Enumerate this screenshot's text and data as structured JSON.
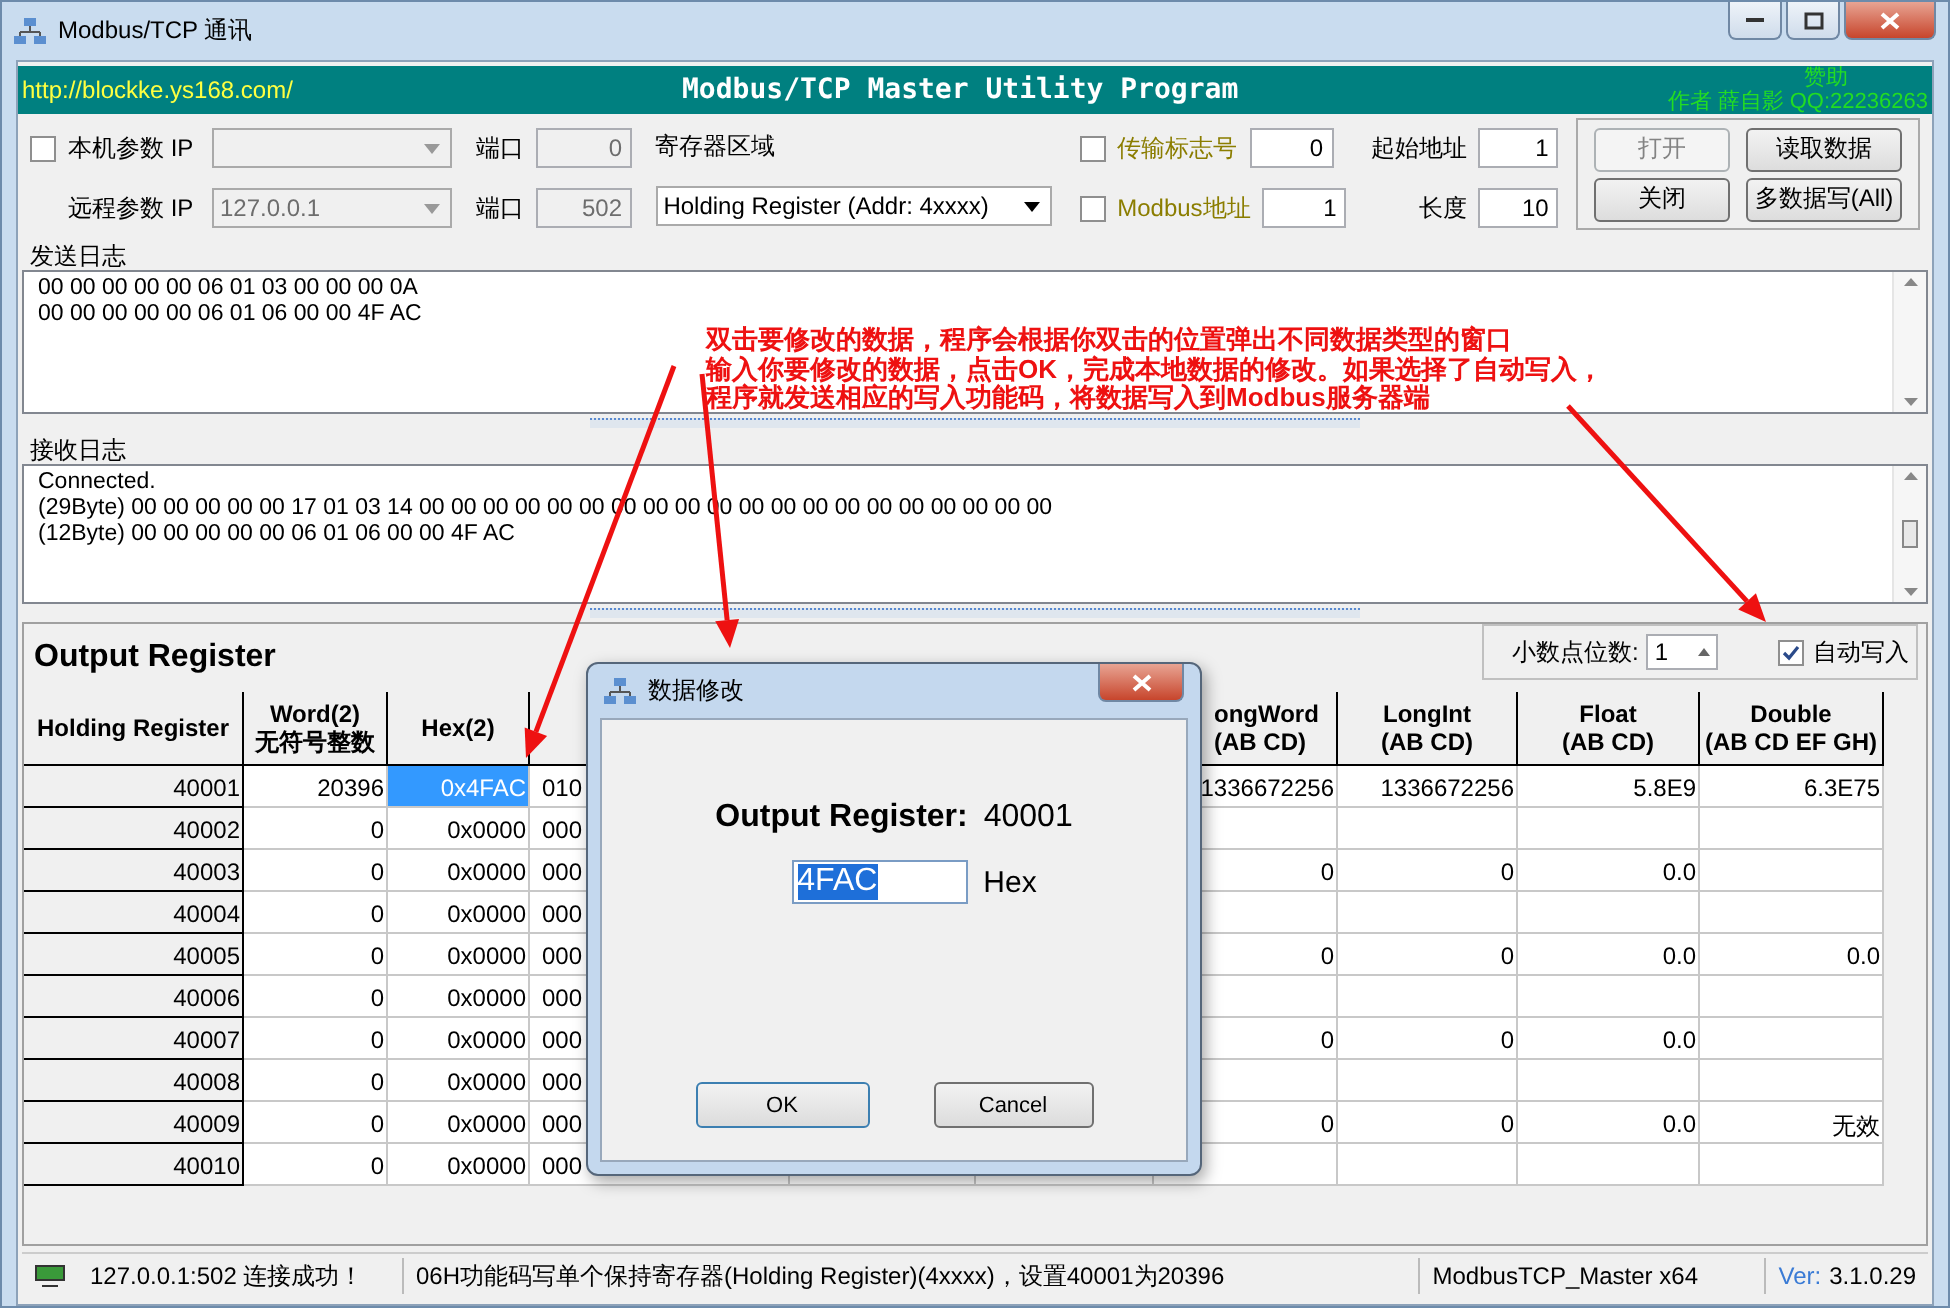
{
  "window": {
    "title": "Modbus/TCP 通讯"
  },
  "header": {
    "link": "http://blockke.ys168.com/",
    "title": "Modbus/TCP Master Utility Program",
    "sponsor": "赞助",
    "author": "作者 薛自影 QQ:22236263"
  },
  "connection": {
    "local": {
      "label": "本机参数 IP",
      "checked": false,
      "port_label": "端口",
      "port": "0"
    },
    "remote": {
      "label": "远程参数 IP",
      "ip": "127.0.0.1",
      "port_label": "端口",
      "port": "502"
    }
  },
  "register_area": {
    "label": "寄存器区域",
    "value": "Holding Register (Addr: 4xxxx)"
  },
  "options": [
    {
      "label": "传输标志号",
      "checked": false,
      "value": "0"
    },
    {
      "label": "Modbus地址",
      "checked": false,
      "value": "1"
    }
  ],
  "address": [
    {
      "label": "起始地址",
      "value": "1"
    },
    {
      "label": "长度",
      "value": "10"
    }
  ],
  "buttons": [
    {
      "label": "打开",
      "disabled": true
    },
    {
      "label": "读取数据",
      "disabled": false
    },
    {
      "label": "关闭",
      "disabled": false
    },
    {
      "label": "多数据写(All)",
      "disabled": false
    }
  ],
  "send_log": {
    "title": "发送日志",
    "lines": [
      "00 00 00 00 00 06 01 03 00 00 00 0A",
      "00 00 00 00 00 06 01 06 00 00 4F AC"
    ]
  },
  "receive_log": {
    "title": "接收日志",
    "lines": [
      "Connected.",
      "(29Byte) 00 00 00 00 00 17 01 03 14 00 00 00 00 00 00 00 00 00 00 00 00 00 00 00 00 00 00 00 00",
      "(12Byte) 00 00 00 00 00 06 01 06 00 00 4F AC"
    ]
  },
  "annotation": {
    "lines": [
      "双击要修改的数据，程序会根据你双击的位置弹出不同数据类型的窗口",
      "输入你要修改的数据，点击OK，完成本地数据的修改。如果选择了自动写入，",
      "程序就发送相应的写入功能码，将数据写入到Modbus服务器端"
    ]
  },
  "output": {
    "title": "Output Register",
    "decimal_label": "小数点位数:",
    "decimal_value": "1",
    "auto_write": {
      "label": "自动写入",
      "checked": true
    },
    "columns": [
      {
        "kind": "header",
        "label": "Holding Register"
      },
      {
        "kind": "header",
        "label": "Word(2)",
        "sublabel": "无符号整数"
      },
      {
        "kind": "header",
        "label": "Hex(2)"
      },
      {
        "kind": "blank"
      },
      {
        "kind": "header",
        "label": "ongWord",
        "sublabel": "(AB CD)"
      },
      {
        "kind": "header",
        "label": "LongInt",
        "sublabel": "(AB CD)"
      },
      {
        "kind": "header",
        "label": "Float",
        "sublabel": "(AB CD)"
      },
      {
        "kind": "header",
        "label": "Double",
        "sublabel": "(AB CD EF GH)"
      }
    ],
    "rows": [
      {
        "cells": [
          {
            "text": "40001",
            "selected": false
          },
          {
            "text": "20396",
            "selected": false
          },
          {
            "text": "0x4FAC",
            "selected": true
          },
          {
            "text": "010",
            "selected": false
          },
          {
            "text": "1336672256",
            "selected": false
          },
          {
            "text": "1336672256",
            "selected": false
          },
          {
            "text": "5.8E9",
            "selected": false
          },
          {
            "text": "6.3E75",
            "selected": false
          }
        ]
      },
      {
        "cells": [
          {
            "text": "40002",
            "selected": false
          },
          {
            "text": "0",
            "selected": false
          },
          {
            "text": "0x0000",
            "selected": false
          },
          {
            "text": "000",
            "selected": false
          },
          {
            "selected": false
          },
          {
            "selected": false
          },
          {
            "selected": false
          },
          {
            "selected": false
          }
        ]
      },
      {
        "cells": [
          {
            "text": "40003",
            "selected": false
          },
          {
            "text": "0",
            "selected": false
          },
          {
            "text": "0x0000",
            "selected": false
          },
          {
            "text": "000",
            "selected": false
          },
          {
            "text": "0",
            "selected": false
          },
          {
            "text": "0",
            "selected": false
          },
          {
            "text": "0.0",
            "selected": false
          },
          {
            "selected": false
          }
        ]
      },
      {
        "cells": [
          {
            "text": "40004",
            "selected": false
          },
          {
            "text": "0",
            "selected": false
          },
          {
            "text": "0x0000",
            "selected": false
          },
          {
            "text": "000",
            "selected": false
          },
          {
            "selected": false
          },
          {
            "selected": false
          },
          {
            "selected": false
          },
          {
            "selected": false
          }
        ]
      },
      {
        "cells": [
          {
            "text": "40005",
            "selected": false
          },
          {
            "text": "0",
            "selected": false
          },
          {
            "text": "0x0000",
            "selected": false
          },
          {
            "text": "000",
            "selected": false
          },
          {
            "text": "0",
            "selected": false
          },
          {
            "text": "0",
            "selected": false
          },
          {
            "text": "0.0",
            "selected": false
          },
          {
            "text": "0.0",
            "selected": false
          }
        ]
      },
      {
        "cells": [
          {
            "text": "40006",
            "selected": false
          },
          {
            "text": "0",
            "selected": false
          },
          {
            "text": "0x0000",
            "selected": false
          },
          {
            "text": "000",
            "selected": false
          },
          {
            "selected": false
          },
          {
            "selected": false
          },
          {
            "selected": false
          },
          {
            "selected": false
          }
        ]
      },
      {
        "cells": [
          {
            "text": "40007",
            "selected": false
          },
          {
            "text": "0",
            "selected": false
          },
          {
            "text": "0x0000",
            "selected": false
          },
          {
            "text": "000",
            "selected": false
          },
          {
            "text": "0",
            "selected": false
          },
          {
            "text": "0",
            "selected": false
          },
          {
            "text": "0.0",
            "selected": false
          },
          {
            "selected": false
          }
        ]
      },
      {
        "cells": [
          {
            "text": "40008",
            "selected": false
          },
          {
            "text": "0",
            "selected": false
          },
          {
            "text": "0x0000",
            "selected": false
          },
          {
            "text": "000",
            "selected": false
          },
          {
            "selected": false
          },
          {
            "selected": false
          },
          {
            "selected": false
          },
          {
            "selected": false
          }
        ]
      },
      {
        "cells": [
          {
            "text": "40009",
            "selected": false
          },
          {
            "text": "0",
            "selected": false
          },
          {
            "text": "0x0000",
            "selected": false
          },
          {
            "text": "000",
            "selected": false
          },
          {
            "text": "0",
            "selected": false
          },
          {
            "text": "0",
            "selected": false
          },
          {
            "text": "0.0",
            "selected": false
          },
          {
            "text": "无效",
            "selected": false
          }
        ]
      },
      {
        "cells": [
          {
            "text": "40010",
            "selected": false
          },
          {
            "text": "0",
            "selected": false
          },
          {
            "text": "0x0000",
            "selected": false
          },
          {
            "text": "000",
            "selected": false
          },
          {
            "selected": false
          },
          {
            "selected": false
          },
          {
            "selected": false
          },
          {
            "selected": false
          }
        ]
      }
    ]
  },
  "dialog": {
    "title": "数据修改",
    "label": "Output Register:",
    "address": "40001",
    "value": "4FAC",
    "unit": "Hex",
    "buttons": [
      "OK",
      "Cancel"
    ]
  },
  "status_bar": {
    "connection": "127.0.0.1:502 连接成功！",
    "message": "06H功能码写单个保持寄存器(Holding Register)(4xxxx)，设置40001为20396",
    "app": "ModbusTCP_Master x64",
    "version_label": "Ver:",
    "version": "3.1.0.29"
  }
}
